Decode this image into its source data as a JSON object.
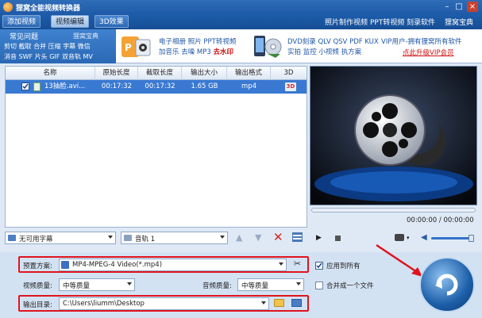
{
  "app": {
    "title": "狸窝全能视频转换器"
  },
  "menubar": {
    "tabs": [
      "添加视频",
      "视频编辑",
      "3D效果"
    ],
    "right_links": [
      "照片制作视频",
      "PPT转视频",
      "刻录软件",
      "狸窝宝典"
    ]
  },
  "banner": {
    "faq_title": "常见问题",
    "faq_sub": "狸窝宝典",
    "faq_links_row1": [
      "剪切",
      "截取",
      "合并",
      "压缩",
      "字幕",
      "微信"
    ],
    "faq_links_row2": [
      "消音",
      "SWF",
      "片头",
      "GIF",
      "双音轨",
      "MV"
    ],
    "promo1_row1": "电子相册 照片 PPT转视频",
    "promo1_row2a": "加音乐 去噪 MP3",
    "promo1_row2b": "去水印",
    "promo2_row1": "DVD刻录 QLV QSV PDF KUX",
    "promo2_row2": "实拍 监控 小视频 执方案",
    "vip_line1": "VIP用户-拥有狸窝所有软件",
    "vip_line2": "点此升级VIP会员"
  },
  "table": {
    "headers": [
      "名称",
      "原始长度",
      "截取长度",
      "输出大小",
      "输出格式",
      "3D"
    ],
    "rows": [
      {
        "name": "13抽脸.avi...",
        "orig_len": "00:17:32",
        "cut_len": "00:17:32",
        "size": "1.65 GB",
        "format": "mp4",
        "threed": "3D"
      }
    ]
  },
  "subtitle_select": {
    "value": "无可用字幕"
  },
  "audio_select": {
    "value": "音轨 1"
  },
  "player": {
    "time": "00:00:00 / 00:00:00"
  },
  "preset": {
    "label": "预置方案:",
    "value": "MP4-MPEG-4 Video(*.mp4)"
  },
  "apply_all": {
    "label": "应用到所有"
  },
  "video_quality": {
    "label": "视频质量:",
    "value": "中等质量"
  },
  "audio_quality": {
    "label": "音频质量:",
    "value": "中等质量"
  },
  "merge": {
    "label": "合并成一个文件"
  },
  "output": {
    "label": "输出目录:",
    "value": "C:\\Users\\liumm\\Desktop"
  },
  "colors": {
    "titlebar": "#1f5aa8",
    "row_selected": "#3979d2",
    "highlight": "#e0141e"
  }
}
